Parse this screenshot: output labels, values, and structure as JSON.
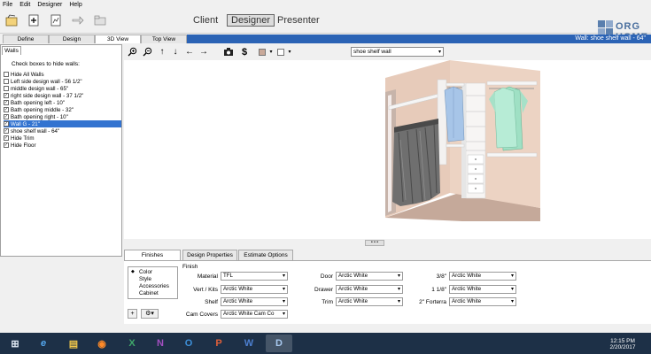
{
  "menu": [
    "File",
    "Edit",
    "Designer",
    "Help"
  ],
  "toolbar": {
    "modes": {
      "client": "Client",
      "designer": "Designer",
      "presenter": "Presenter"
    }
  },
  "logo": {
    "line1": "ORG",
    "line2": "HOME."
  },
  "view_tabs": [
    "Define",
    "Design",
    "3D View",
    "Top View"
  ],
  "active_view_tab": "3D View",
  "wall_title": "Wall: shoe shelf wall - 64\"",
  "walls_panel": {
    "tab": "Walls",
    "header": "Check boxes to hide walls:",
    "items": [
      {
        "label": "Hide All Walls",
        "checked": false,
        "selected": false
      },
      {
        "label": "Left side design wall - 56 1/2\"",
        "checked": false,
        "selected": false
      },
      {
        "label": "middle design wall - 65\"",
        "checked": false,
        "selected": false
      },
      {
        "label": "right side design wall - 37 1/2\"",
        "checked": true,
        "selected": false
      },
      {
        "label": "Bath opening left - 10\"",
        "checked": true,
        "selected": false
      },
      {
        "label": "Bath opening middle - 32\"",
        "checked": true,
        "selected": false
      },
      {
        "label": "Bath opening right - 10\"",
        "checked": true,
        "selected": false
      },
      {
        "label": "Wall G - 21\"",
        "checked": true,
        "selected": true
      },
      {
        "label": "shoe shelf wall - 64\"",
        "checked": true,
        "selected": false
      },
      {
        "label": "Hide Trim",
        "checked": true,
        "selected": false
      },
      {
        "label": "Hide Floor",
        "checked": true,
        "selected": false
      }
    ]
  },
  "view_toolbar": {
    "icons": [
      "zoom-in-icon",
      "zoom-out-icon",
      "arrow-up-icon",
      "arrow-down-icon",
      "arrow-left-icon",
      "arrow-right-icon",
      "camera-icon",
      "dollar-icon"
    ],
    "wall_select": "shoe shelf wall",
    "wall_color": "#c9a99a",
    "floor_color": "#ffffff"
  },
  "bottom_tabs": [
    "Finishes",
    "Design Properties",
    "Estimate Options"
  ],
  "finishes": {
    "tree": [
      "Color",
      "Style",
      "Accessories",
      "Cabinet"
    ],
    "section_label": "Finish",
    "fields_col1": [
      {
        "label": "Material",
        "value": "TFL"
      },
      {
        "label": "Vert / Kits",
        "value": "Arctic White"
      },
      {
        "label": "Shelf",
        "value": "Arctic White"
      },
      {
        "label": "Cam Covers",
        "value": "Arctic White Cam Co"
      }
    ],
    "fields_col2": [
      {
        "label": "Door",
        "value": "Arctic White"
      },
      {
        "label": "Drawer",
        "value": "Arctic White"
      },
      {
        "label": "Trim",
        "value": "Arctic White"
      }
    ],
    "fields_col3": [
      {
        "label": "3/8\"",
        "value": "Arctic White"
      },
      {
        "label": "1 1/8\"",
        "value": "Arctic White"
      },
      {
        "label": "2\" Forterra",
        "value": "Arctic White"
      }
    ],
    "add_button": "+",
    "settings_button": "⚙▾"
  },
  "taskbar": {
    "apps": [
      "windows-logo",
      "internet-explorer",
      "file-explorer",
      "firefox",
      "excel",
      "onenote",
      "outlook",
      "powerpoint",
      "word",
      "designer-app"
    ],
    "app_glyphs": [
      "⊞",
      "e",
      "▤",
      "◉",
      "X",
      "N",
      "O",
      "P",
      "W",
      "D"
    ],
    "time": "12:15 PM",
    "date": "2/20/2017"
  }
}
